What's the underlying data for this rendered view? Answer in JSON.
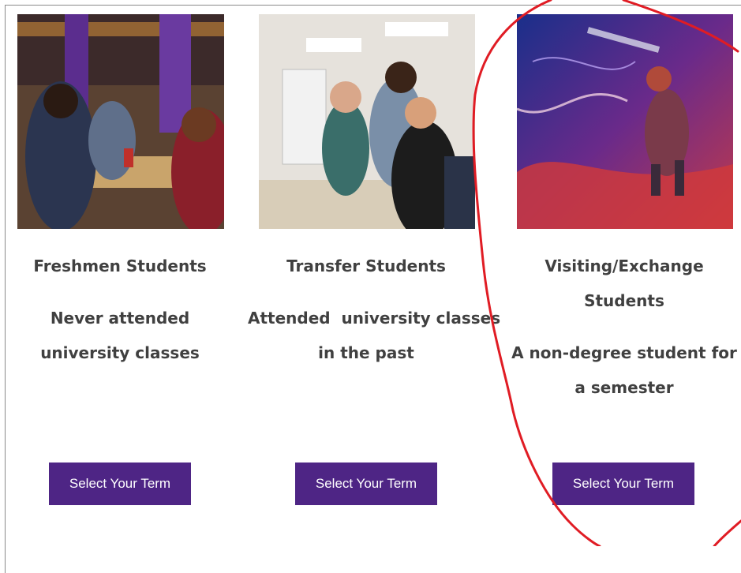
{
  "cards": [
    {
      "title": "Freshmen Students",
      "description_line1": "Never attended",
      "description_line2": "university classes",
      "button_label": "Select Your Term"
    },
    {
      "title": "Transfer Students",
      "description_line1": "Attended  university classes",
      "description_line2": "in the past",
      "button_label": "Select Your Term"
    },
    {
      "title_line1": "Visiting/Exchange",
      "title_line2": "Students",
      "description_line1": "A non-degree student for",
      "description_line2": "a semester",
      "button_label": "Select Your Term"
    }
  ],
  "colors": {
    "button_bg": "#4e2585",
    "text": "#404040",
    "annotation": "#e01c24"
  }
}
